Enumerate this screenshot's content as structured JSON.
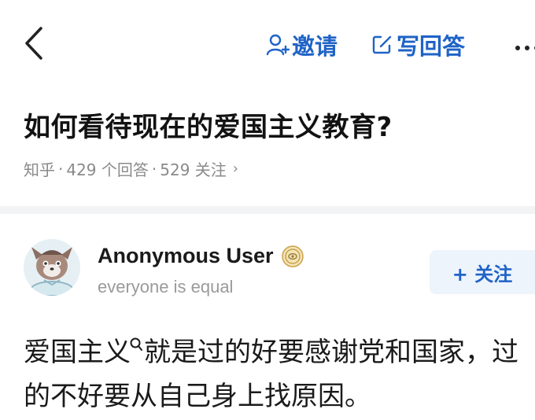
{
  "topbar": {
    "invite_label": "邀请",
    "write_answer_label": "写回答"
  },
  "question": {
    "title": "如何看待现在的爱国主义教育?",
    "meta": {
      "site": "知乎",
      "answers": "429 个回答",
      "followers": "529 关注"
    }
  },
  "author": {
    "name": "Anonymous User",
    "bio": "everyone is equal",
    "follow_label": "+ 关注"
  },
  "answer": {
    "text_before_icon": "爱国主义",
    "text_after_icon": "就是过的好要感谢党和国家，过的不好要从自己身上找原因。"
  },
  "colors": {
    "accent": "#1f63c6",
    "meta_gray": "#8a8a8a",
    "follow_bg": "#eef4fc"
  }
}
